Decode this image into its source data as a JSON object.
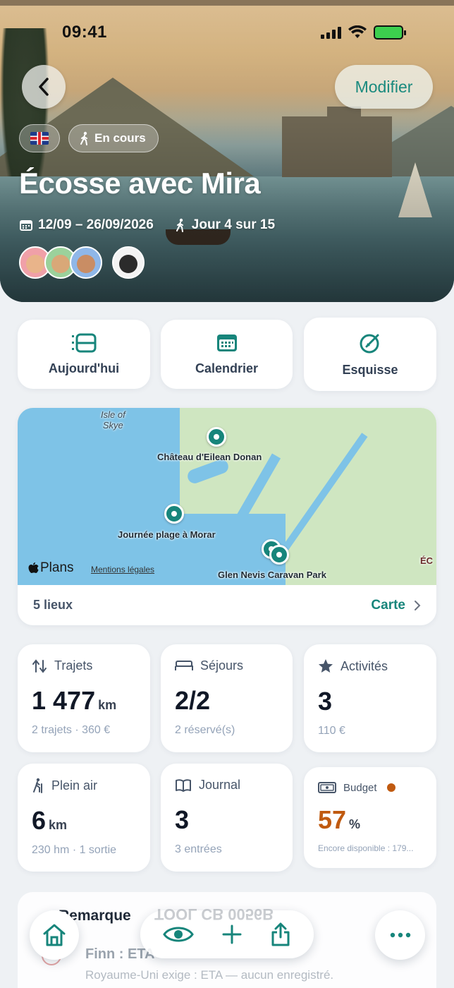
{
  "status_bar": {
    "time": "09:41"
  },
  "header": {
    "back_label": "",
    "edit_label": "Modifier",
    "status_pill": "En cours",
    "title": "Écosse avec Mira",
    "dates": "12/09 – 26/09/2026",
    "day_progress": "Jour 4 sur 15"
  },
  "quick_actions": [
    {
      "label": "Aujourd'hui",
      "icon": "list-icon"
    },
    {
      "label": "Calendrier",
      "icon": "calendar-icon"
    },
    {
      "label": "Esquisse",
      "icon": "compass-pen-icon"
    }
  ],
  "map": {
    "labels": {
      "isle_of_skye_1": "Isle of",
      "isle_of_skye_2": "Skye",
      "castle": "Château d'Eilean Donan",
      "beach": "Journée plage à Morar",
      "camp": "Glen Nevis Caravan Park",
      "edge": "ÉC"
    },
    "plans_brand": "Plans",
    "legal": "Mentions légales",
    "count": "5 lieux",
    "link": "Carte"
  },
  "stats": {
    "trajets": {
      "title": "Trajets",
      "value": "1 477",
      "unit": "km",
      "sub": "2 trajets · 360 €"
    },
    "sejours": {
      "title": "Séjours",
      "value": "2/2",
      "sub": "2 réservé(s)"
    },
    "activites": {
      "title": "Activités",
      "value": "3",
      "sub": "110 €"
    },
    "plein_air": {
      "title": "Plein air",
      "value": "6",
      "unit": "km",
      "sub": "230 hm · 1 sortie"
    },
    "journal": {
      "title": "Journal",
      "value": "3",
      "sub": "3 entrées"
    },
    "budget": {
      "title": "Budget",
      "value": "57",
      "unit": "%",
      "sub": "Encore disponible : 179..."
    }
  },
  "remark": {
    "title": "Remarque",
    "line1": "Finn : ETA",
    "line2": "Royaume-Uni exige : ETA — aucun enregistré."
  },
  "bottom_bar": {
    "ghost_text": "TOOL CB 0056B"
  },
  "colors": {
    "accent": "#17857b",
    "budget": "#c05a10"
  }
}
